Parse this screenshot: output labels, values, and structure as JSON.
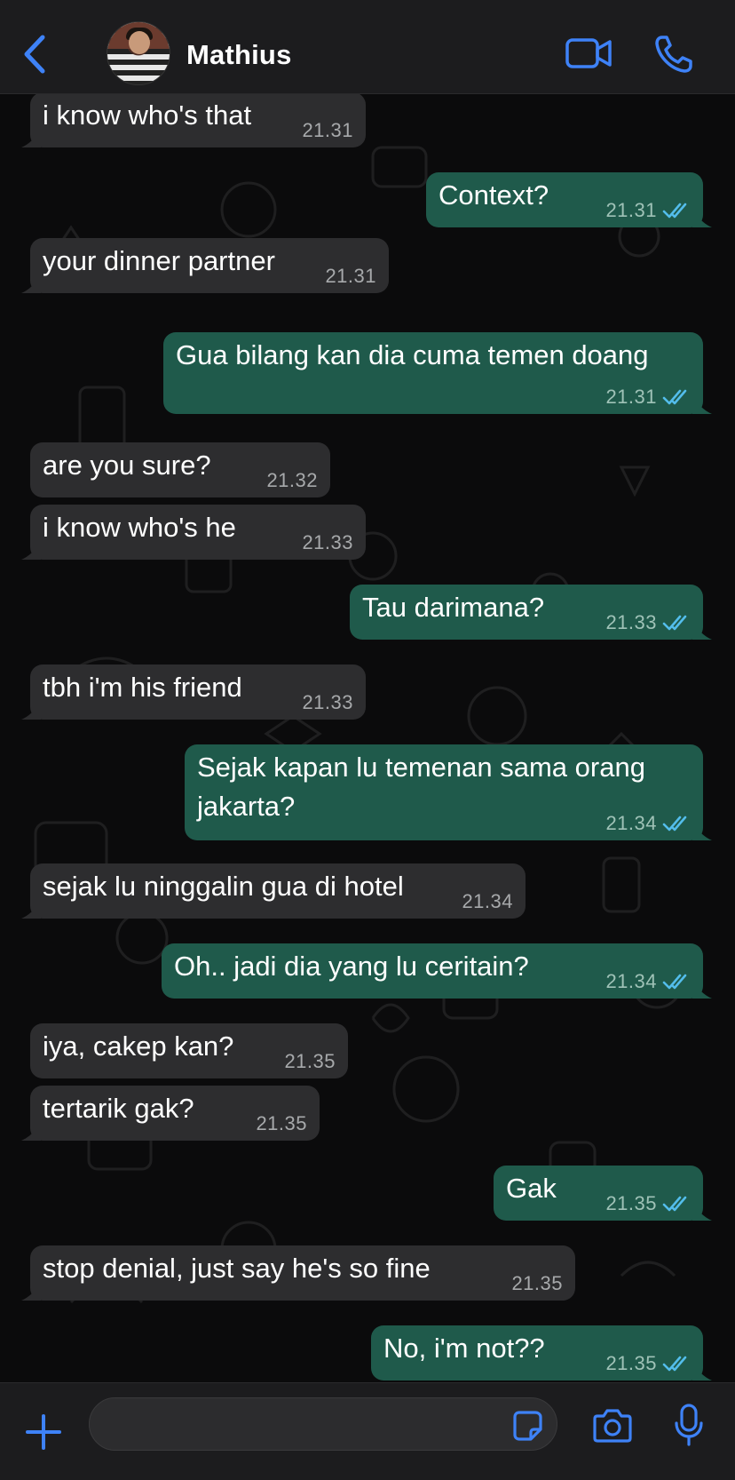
{
  "header": {
    "back_icon": "chevron-left-icon",
    "contact_name": "Mathius",
    "video_icon": "video-camera-icon",
    "call_icon": "phone-icon",
    "accent_color": "#3e82f7"
  },
  "messages": [
    {
      "direction": "in",
      "text": "i know who's that",
      "time": "21.31"
    },
    {
      "direction": "out",
      "text": "Context?",
      "time": "21.31",
      "status": "read"
    },
    {
      "direction": "in",
      "text": "your dinner partner",
      "time": "21.31"
    },
    {
      "direction": "out",
      "text": "Gua bilang kan dia cuma temen doang",
      "time": "21.31",
      "status": "read"
    },
    {
      "direction": "in",
      "text": "are you sure?",
      "time": "21.32"
    },
    {
      "direction": "in",
      "text": "i know who's he",
      "time": "21.33"
    },
    {
      "direction": "out",
      "text": "Tau darimana?",
      "time": "21.33",
      "status": "read"
    },
    {
      "direction": "in",
      "text": "tbh i'm his friend",
      "time": "21.33"
    },
    {
      "direction": "out",
      "text": "Sejak kapan lu temenan sama orang jakarta?",
      "time": "21.34",
      "status": "read"
    },
    {
      "direction": "in",
      "text": "sejak lu ninggalin gua di hotel",
      "time": "21.34"
    },
    {
      "direction": "out",
      "text": "Oh.. jadi dia yang lu ceritain?",
      "time": "21.34",
      "status": "read"
    },
    {
      "direction": "in",
      "text": "iya, cakep kan?",
      "time": "21.35"
    },
    {
      "direction": "in",
      "text": "tertarik gak?",
      "time": "21.35"
    },
    {
      "direction": "out",
      "text": "Gak",
      "time": "21.35",
      "status": "read"
    },
    {
      "direction": "in",
      "text": "stop denial, just say he's so fine",
      "time": "21.35"
    },
    {
      "direction": "out",
      "text": "No, i'm not??",
      "time": "21.35",
      "status": "read"
    }
  ],
  "composer": {
    "input_value": "",
    "plus_icon": "plus-icon",
    "sticker_icon": "sticker-icon",
    "camera_icon": "camera-icon",
    "mic_icon": "microphone-icon"
  },
  "colors": {
    "incoming_bubble": "#2d2d2f",
    "outgoing_bubble": "#1f5a4b",
    "read_tick": "#53bdeb"
  }
}
